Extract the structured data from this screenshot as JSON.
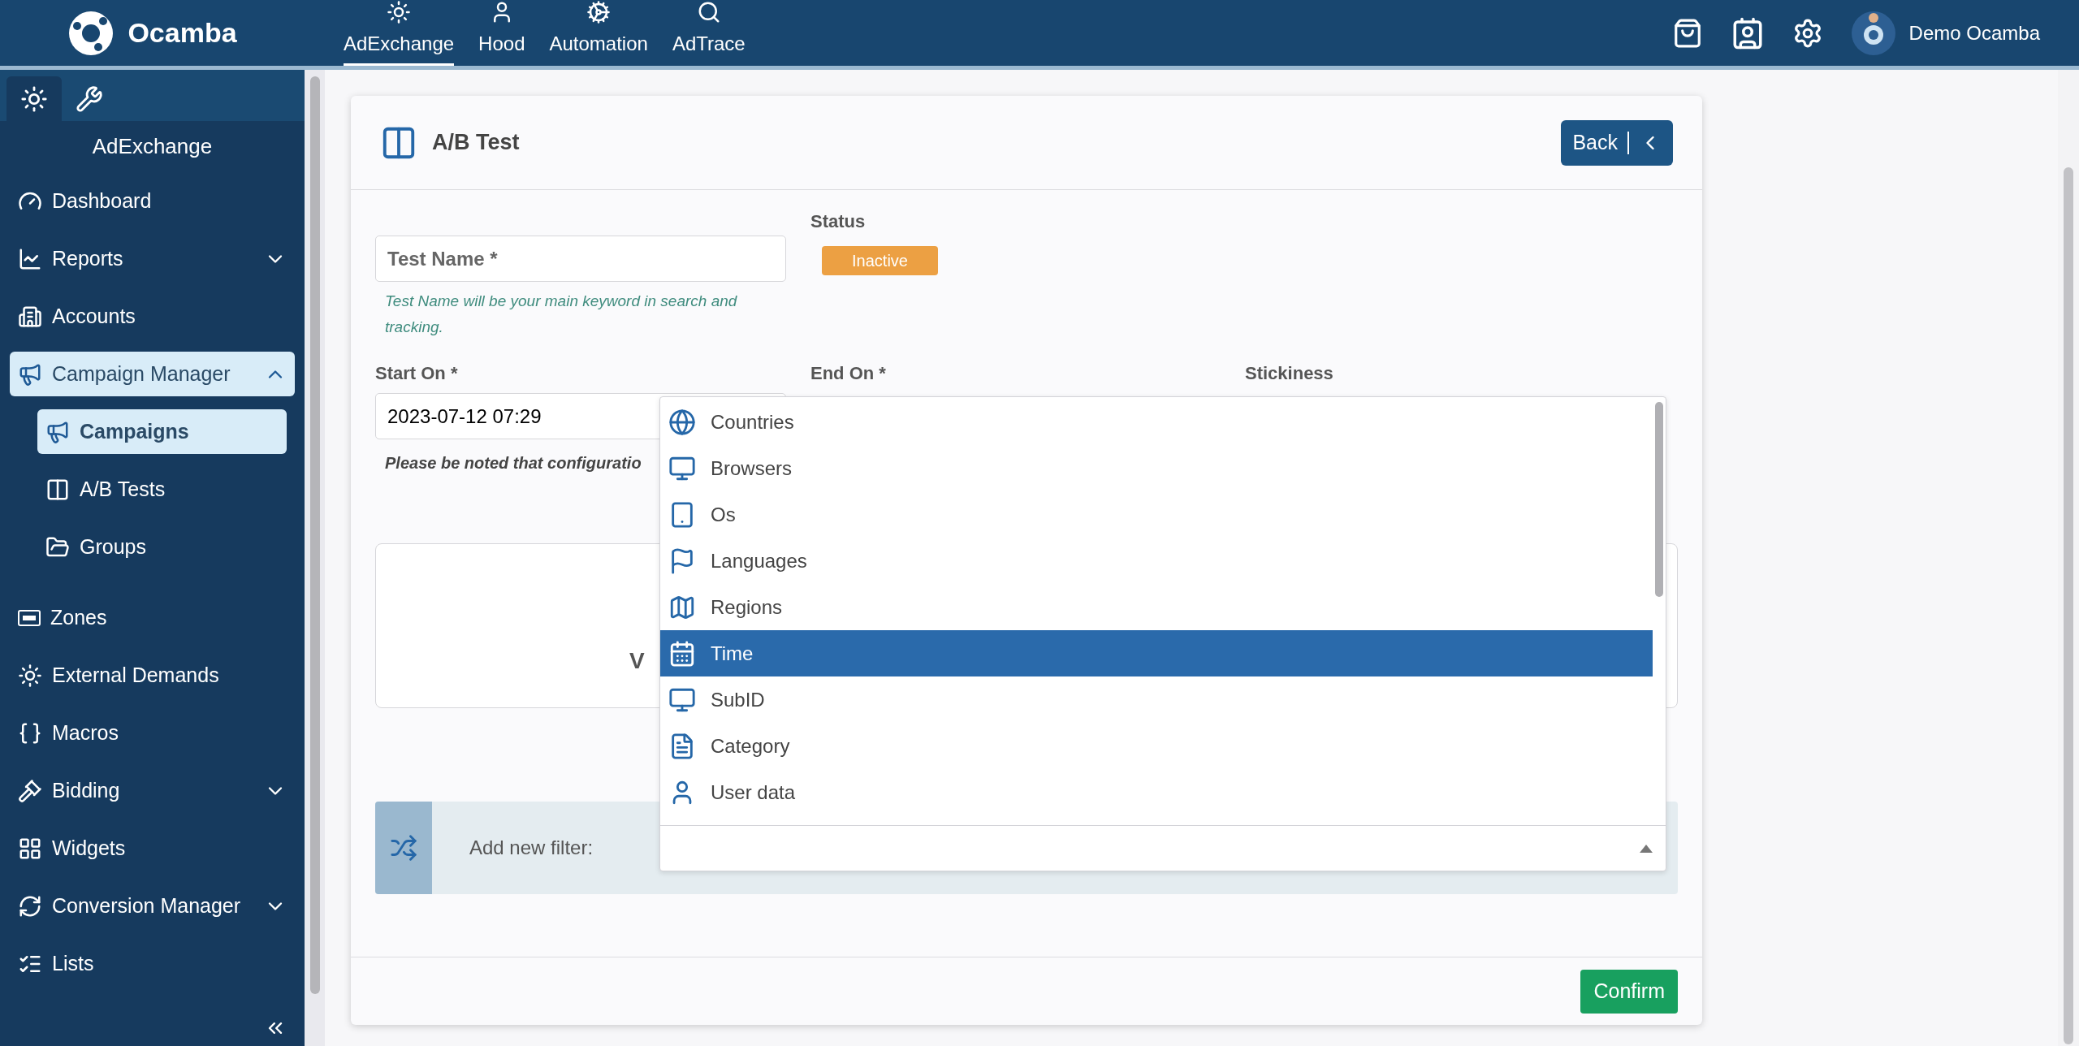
{
  "top_bar": {
    "logo": "Ocamba",
    "apps": [
      {
        "label": "AdExchange",
        "selected": true
      },
      {
        "label": "Hood",
        "selected": false
      },
      {
        "label": "Automation",
        "selected": false
      },
      {
        "label": "AdTrace",
        "selected": false
      }
    ],
    "user": "Demo Ocamba"
  },
  "sidebar": {
    "tabs": [
      {
        "selected": true
      },
      {
        "selected": false
      }
    ],
    "section_title": "AdExchange",
    "items": [
      {
        "label": "Dashboard",
        "selected": false
      },
      {
        "label": "Reports",
        "selected": false,
        "expanded": false
      },
      {
        "label": "Accounts",
        "selected": false
      },
      {
        "label": "Campaign Manager",
        "selected": true,
        "expanded": true,
        "children": [
          {
            "label": "Campaigns",
            "selected": true
          },
          {
            "label": "A/B Tests",
            "selected": false
          },
          {
            "label": "Groups",
            "selected": false
          }
        ]
      },
      {
        "label": "Zones",
        "selected": false
      },
      {
        "label": "External Demands",
        "selected": false
      },
      {
        "label": "Macros",
        "selected": false
      },
      {
        "label": "Bidding",
        "selected": false,
        "expanded": false
      },
      {
        "label": "Widgets",
        "selected": false
      },
      {
        "label": "Conversion Manager",
        "selected": false,
        "expanded": false
      },
      {
        "label": "Lists",
        "selected": false
      }
    ]
  },
  "form": {
    "title": "A/B Test",
    "back": "Back",
    "test_name": {
      "placeholder": "Test Name *",
      "hint": "Test Name will be your main keyword in search and tracking."
    },
    "status": {
      "label": "Status",
      "value": "Inactive"
    },
    "start_on": {
      "label": "Start On *",
      "value": "2023-07-12 07:29"
    },
    "end_on": {
      "label": "End On *"
    },
    "stickiness": {
      "label": "Stickiness"
    },
    "note": "Please be noted that configuratio",
    "box_text": "V",
    "filter": {
      "label": "Add new filter:",
      "options": [
        {
          "label": "Countries",
          "selected": false
        },
        {
          "label": "Browsers",
          "selected": false
        },
        {
          "label": "Os",
          "selected": false
        },
        {
          "label": "Languages",
          "selected": false
        },
        {
          "label": "Regions",
          "selected": false
        },
        {
          "label": "Time",
          "selected": true
        },
        {
          "label": "SubID",
          "selected": false
        },
        {
          "label": "Category",
          "selected": false
        },
        {
          "label": "User data",
          "selected": false
        }
      ]
    },
    "confirm": "Confirm"
  }
}
